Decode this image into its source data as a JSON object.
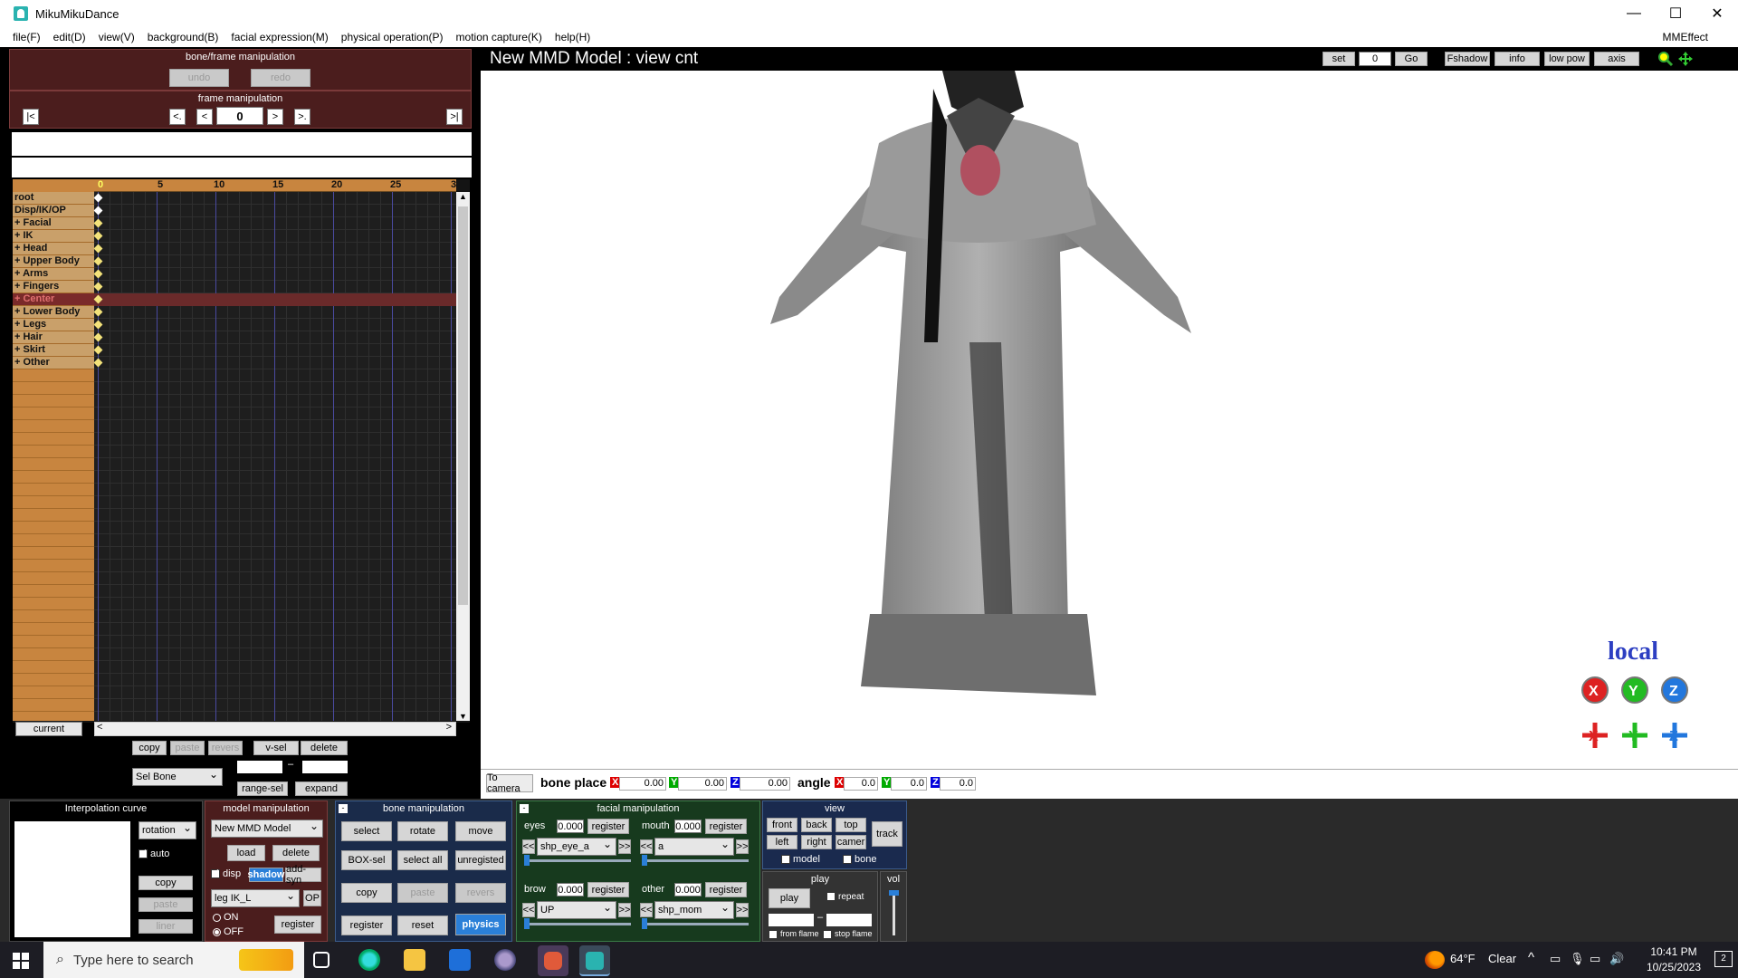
{
  "window": {
    "title": "MikuMikuDance",
    "minimize": "—",
    "maximize": "☐",
    "close": "✕"
  },
  "menu": {
    "items": [
      "file(F)",
      "edit(D)",
      "view(V)",
      "background(B)",
      "facial expression(M)",
      "physical operation(P)",
      "motion capture(K)",
      "help(H)"
    ],
    "right": "MMEffect"
  },
  "bone_frame": {
    "title": "bone/frame manipulation",
    "undo": "undo",
    "redo": "redo"
  },
  "frame_manip": {
    "title": "frame manipulation",
    "first": "|<",
    "prev_key": "<.",
    "prev": "<",
    "frame": "0",
    "next": ">",
    "next_key": ">.",
    "last": ">|"
  },
  "timeline": {
    "ruler": [
      "0",
      "5",
      "10",
      "15",
      "20",
      "25",
      "3"
    ],
    "bones": [
      "root",
      "Disp/IK/OP",
      "+ Facial",
      "+ IK",
      "+ Head",
      "+ Upper Body",
      "+ Arms",
      "+ Fingers",
      "+ Center",
      "+ Lower Body",
      "+ Legs",
      "+ Hair",
      "+ Skirt",
      "+ Other"
    ],
    "selected_index": 8,
    "current": "current"
  },
  "timeline_tools": {
    "copy": "copy",
    "paste": "paste",
    "revers": "revers",
    "vsel": "v-sel",
    "delete": "delete",
    "selbone": "Sel Bone",
    "range_sel": "range-sel",
    "expand": "expand",
    "dash": "–"
  },
  "viewport": {
    "title": "New MMD Model : view cnt",
    "set": "set",
    "frame": "0",
    "go": "Go",
    "fshadow": "Fshadow",
    "info": "info",
    "lowpow": "low pow",
    "axis": "axis",
    "local": "local",
    "to_camera": "To camera",
    "bone_place": "bone place",
    "x": "X",
    "y": "Y",
    "z": "Z",
    "px": "0.00",
    "py": "0.00",
    "pz": "0.00",
    "angle": "angle",
    "ax": "0.0",
    "ay": "0.0",
    "az": "0.0"
  },
  "interp": {
    "title": "Interpolation curve",
    "mode": "rotation",
    "auto": "auto",
    "copy": "copy",
    "paste": "paste",
    "liner": "liner"
  },
  "model": {
    "title": "model manipulation",
    "model": "New MMD Model",
    "load": "load",
    "delete": "delete",
    "disp": "disp",
    "shadow": "shadow",
    "addsyn": "add-syn",
    "bone": "leg IK_L",
    "op": "OP",
    "on": "ON",
    "off": "OFF",
    "register": "register"
  },
  "bone": {
    "title": "bone manipulation",
    "select": "select",
    "rotate": "rotate",
    "move": "move",
    "boxsel": "BOX-sel",
    "selectall": "select all",
    "unregistered": "unregisted",
    "copy": "copy",
    "paste": "paste",
    "revers": "revers",
    "register": "register",
    "reset": "reset",
    "physics": "physics"
  },
  "facial": {
    "title": "facial manipulation",
    "eyes": "eyes",
    "eyes_val": "0.000",
    "eyes_sel": "shp_eye_a",
    "mouth": "mouth",
    "mouth_val": "0.000",
    "mouth_sel": "a",
    "brow": "brow",
    "brow_val": "0.000",
    "brow_sel": "UP",
    "other": "other",
    "other_val": "0.000",
    "other_sel": "shp_mom",
    "register": "register",
    "prev": "<<",
    "next": ">>"
  },
  "view": {
    "title": "view",
    "front": "front",
    "back": "back",
    "top": "top",
    "track": "track",
    "left": "left",
    "right": "right",
    "camer": "camer",
    "model": "model",
    "bone": "bone"
  },
  "play": {
    "title": "play",
    "play": "play",
    "repeat": "repeat",
    "dash": "–",
    "from": "from flame",
    "stop": "stop flame",
    "vol": "vol"
  },
  "taskbar": {
    "search": "Type here to search",
    "temp": "64°F",
    "weather": "Clear",
    "time": "10:41 PM",
    "date": "10/25/2023",
    "notif": "2"
  }
}
